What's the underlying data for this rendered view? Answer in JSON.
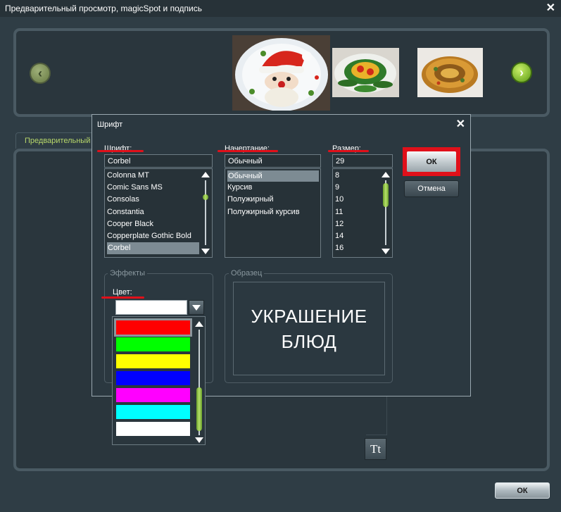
{
  "window": {
    "title": "Предварительный просмотр, magicSpot и подпись",
    "close_glyph": "✕"
  },
  "carousel": {
    "prev_glyph": "‹",
    "next_glyph": "›",
    "prev_icon": "chevron-left-icon",
    "next_icon": "chevron-right-icon"
  },
  "tabs": {
    "preview_label": "Предварительный"
  },
  "toolbar": {
    "tt_label": "Tt"
  },
  "footer": {
    "ok_label": "ОК"
  },
  "font_dialog": {
    "title": "Шрифт",
    "close_glyph": "✕",
    "font": {
      "label": "Шрифт:",
      "value": "Corbel",
      "items": [
        "Colonna MT",
        "Comic Sans MS",
        "Consolas",
        "Constantia",
        "Cooper Black",
        "Copperplate Gothic Bold",
        "Corbel"
      ],
      "selected_index": 6
    },
    "style": {
      "label": "Начертание:",
      "value": "Обычный",
      "items": [
        "Обычный",
        "Курсив",
        "Полужирный",
        "Полужирный курсив"
      ],
      "selected_index": 0
    },
    "size": {
      "label": "Размер:",
      "value": "29",
      "items": [
        "8",
        "9",
        "10",
        "11",
        "12",
        "14",
        "16"
      ]
    },
    "ok_label": "ОК",
    "cancel_label": "Отмена",
    "effects": {
      "group_label": "Эффекты",
      "color_label": "Цвет:",
      "selected_color": "#ffffff",
      "colors": [
        "#ff0000",
        "#00ff00",
        "#ffff00",
        "#0000ff",
        "#ff00ff",
        "#00ffff",
        "#ffffff"
      ],
      "highlighted_index": 0
    },
    "sample": {
      "group_label": "Образец",
      "line1": "УКРАШЕНИЕ",
      "line2": "БЛЮД"
    }
  },
  "colors": {
    "accent_red": "#e0101a",
    "scroll_green": "#8cc63f",
    "tab_text": "#b8d86a"
  }
}
